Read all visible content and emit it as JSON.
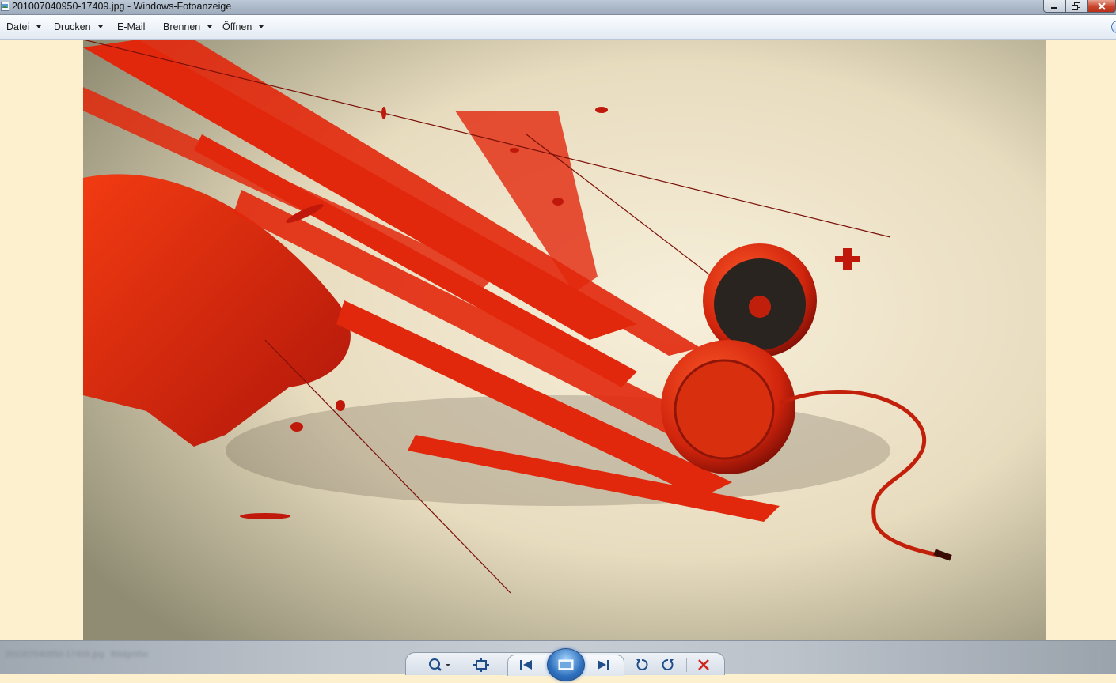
{
  "window": {
    "title": "201007040950-17409.jpg - Windows-Fotoanzeige",
    "icon": "photo-viewer-icon",
    "buttons": [
      "minimize-icon",
      "restore-icon",
      "close-icon"
    ]
  },
  "menu": {
    "items": [
      {
        "label": "Datei",
        "has_dropdown": true
      },
      {
        "label": "Drucken",
        "has_dropdown": true
      },
      {
        "label": "E-Mail",
        "has_dropdown": false
      },
      {
        "label": "Brennen",
        "has_dropdown": true
      },
      {
        "label": "Öffnen",
        "has_dropdown": true
      }
    ],
    "help_icon": "help-icon"
  },
  "image": {
    "description_icon": "red-headphones-splash-artwork",
    "accent": "#e02a0e",
    "background": "#ede3c8"
  },
  "statusbar": {
    "blurred_left": "201007040950-17409.jpg",
    "blurred_mid": "Bildgröße"
  },
  "toolbar": {
    "controls": [
      "zoom-icon",
      "actual-size-icon",
      "previous-icon",
      "slideshow-icon",
      "next-icon",
      "rotate-left-icon",
      "rotate-right-icon",
      "delete-icon"
    ]
  }
}
